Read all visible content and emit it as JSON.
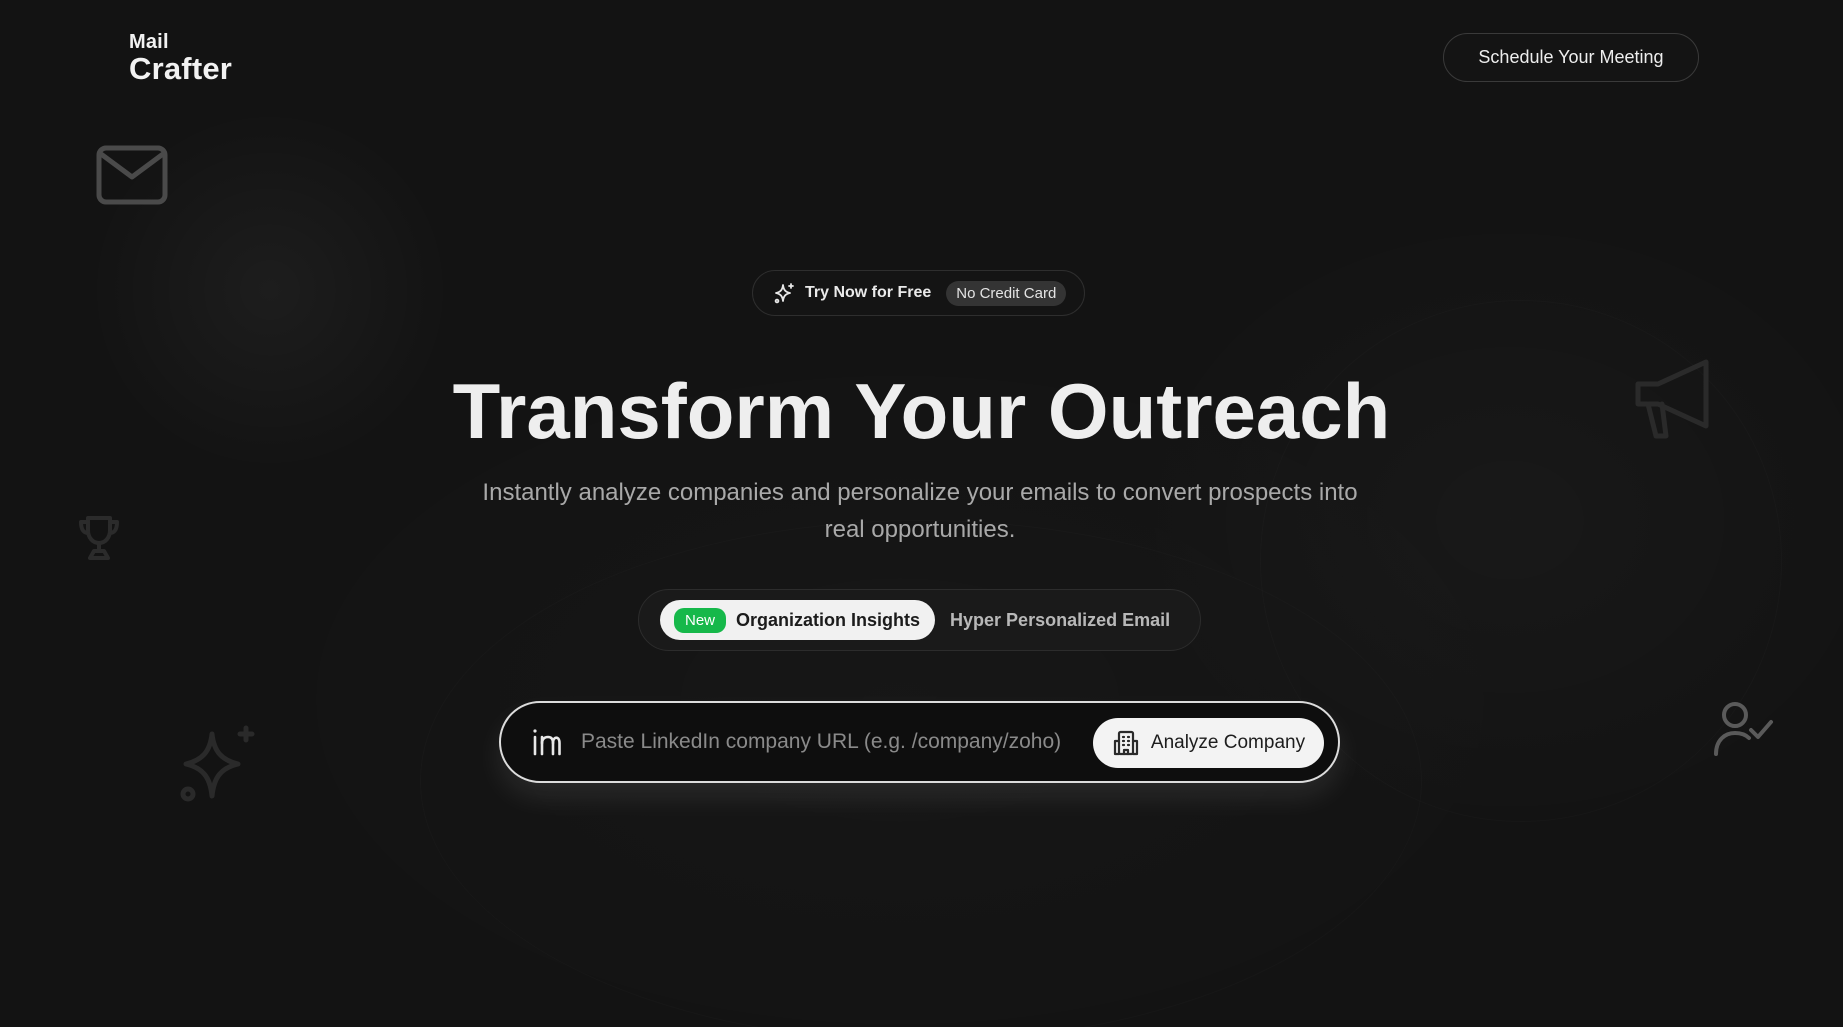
{
  "header": {
    "logo_line1": "Mail",
    "logo_line2": "Crafter",
    "schedule_label": "Schedule Your Meeting"
  },
  "promo": {
    "try_label": "Try Now for Free",
    "badge_label": "No Credit Card"
  },
  "hero": {
    "title": "Transform Your Outreach",
    "subtitle": "Instantly analyze companies and personalize your emails to convert prospects into real opportunities."
  },
  "tabs": [
    {
      "badge": "New",
      "label": "Organization Insights",
      "active": true
    },
    {
      "label": "Hyper Personalized Email",
      "active": false
    }
  ],
  "search": {
    "placeholder": "Paste LinkedIn company URL (e.g. /company/zoho)",
    "value": "",
    "button_label": "Analyze Company"
  },
  "icons": {
    "linkedin": "linkedin-icon",
    "building": "building-icon",
    "sparkle": "sparkle-icon",
    "decorative": [
      "mail-icon",
      "trophy-icon",
      "sparkle-icon",
      "megaphone-icon",
      "user-check-icon"
    ]
  },
  "colors": {
    "background": "#131313",
    "accent_green": "#16b84a",
    "button_light": "#f3f3f3"
  }
}
